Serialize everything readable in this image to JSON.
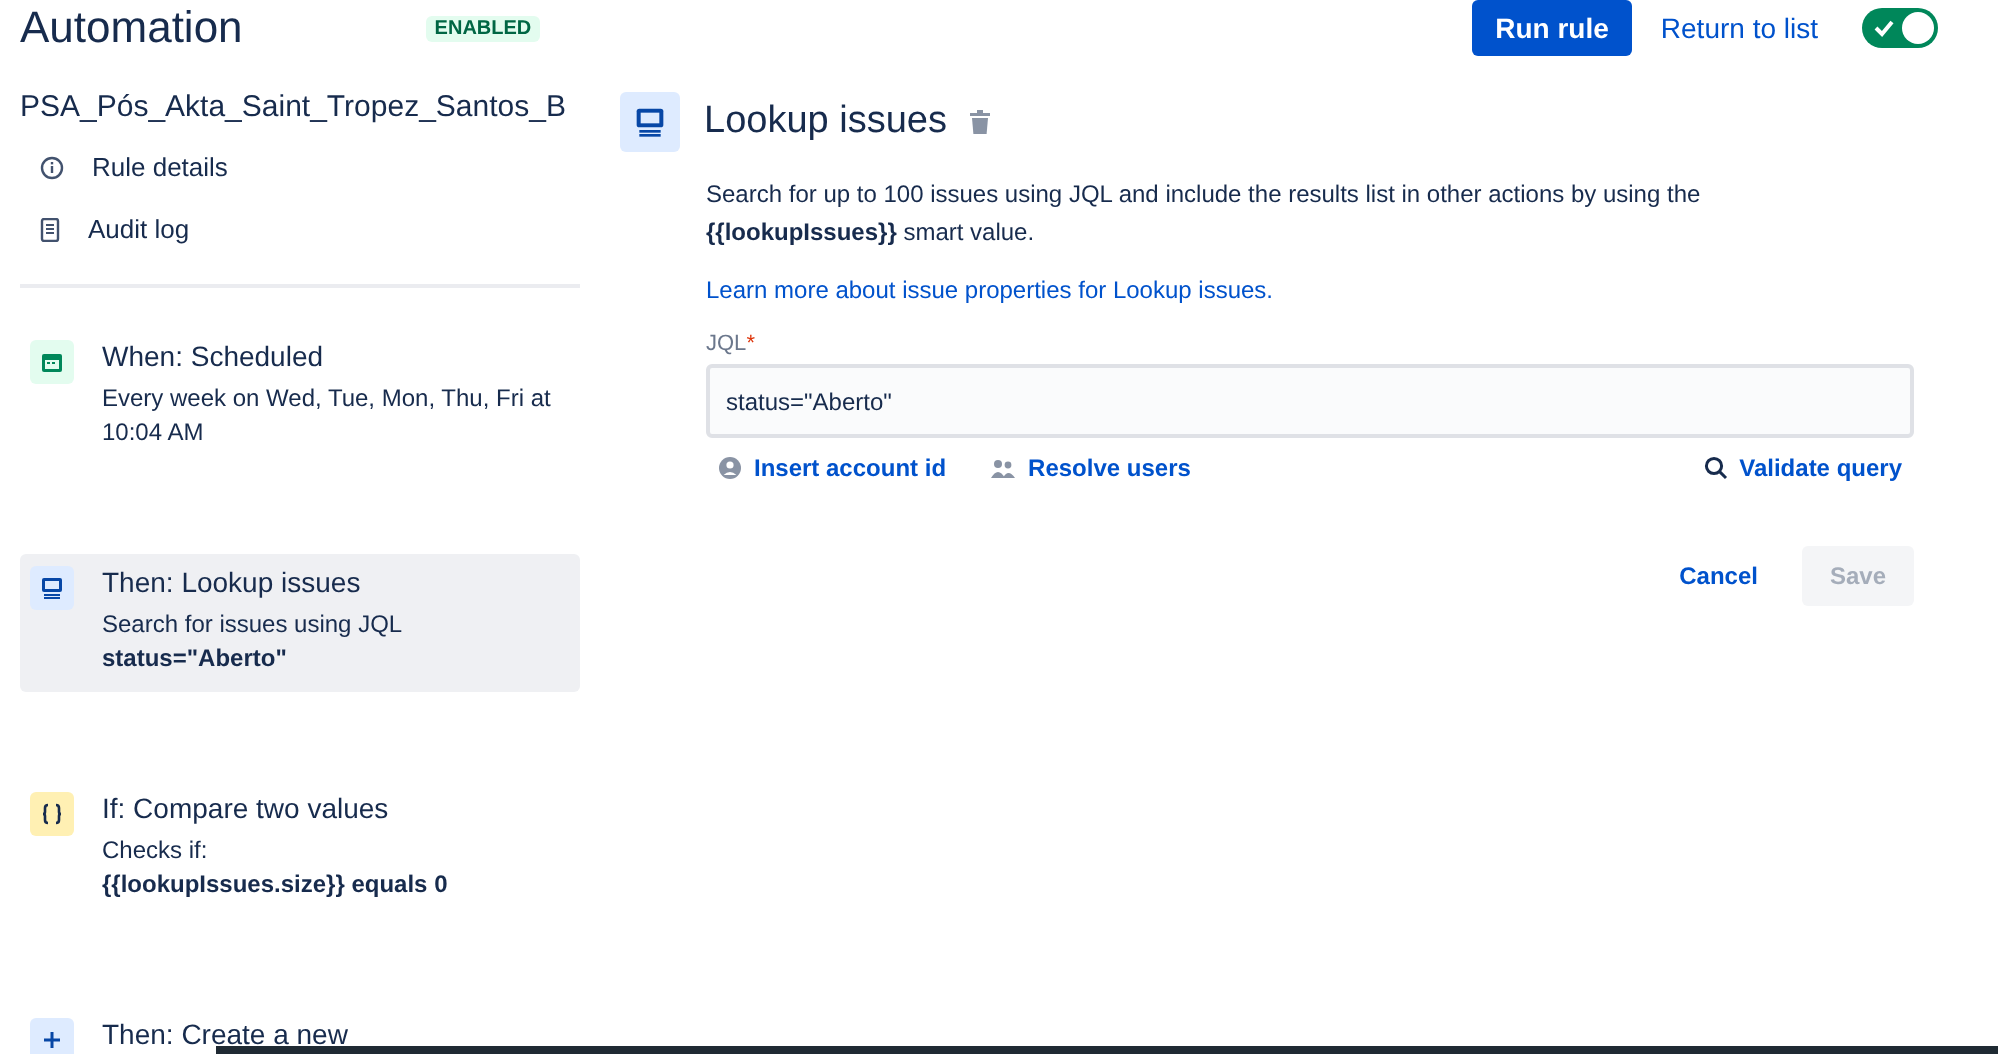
{
  "header": {
    "title": "Automation",
    "status_badge": "ENABLED",
    "run_button": "Run rule",
    "return_link": "Return to list",
    "rule_toggle": {
      "on": true
    }
  },
  "sidebar": {
    "rule_name": "PSA_Pós_Akta_Saint_Tropez_Santos_B",
    "links": [
      {
        "kind": "info",
        "label": "Rule details"
      },
      {
        "kind": "log",
        "label": "Audit log"
      }
    ],
    "steps": [
      {
        "kind": "trigger",
        "title": "When: Scheduled",
        "lines": [
          "Every week on Wed, Tue, Mon, Thu, Fri at 10:04 AM"
        ],
        "selected": false
      },
      {
        "kind": "action",
        "title": "Then: Lookup issues",
        "lines": [
          "Search for issues using JQL",
          "**status=\"Aberto\"**"
        ],
        "selected": true
      },
      {
        "kind": "condition",
        "title": "If: Compare two values",
        "lines": [
          "Checks if:",
          "**{{lookupIssues.size}} equals 0**"
        ],
        "selected": false
      },
      {
        "kind": "add",
        "title": "Then: Create a new",
        "selected": false
      }
    ]
  },
  "panel": {
    "title": "Lookup issues",
    "description": "Search for up to 100 issues using JQL and include the results list in other actions by using the **{{lookupIssues}}** smart value.",
    "learn_link": "Learn more about issue properties for Lookup issues.",
    "field_label": "JQL",
    "required_mark": "*",
    "field_value": "status=\"Aberto\"",
    "helpers": [
      {
        "kind": "account",
        "label": "Insert account id"
      },
      {
        "kind": "users",
        "label": "Resolve users"
      },
      {
        "kind": "search",
        "label": "Validate query"
      }
    ],
    "cancel": "Cancel",
    "save": {
      "label": "Save",
      "disabled": true
    }
  }
}
